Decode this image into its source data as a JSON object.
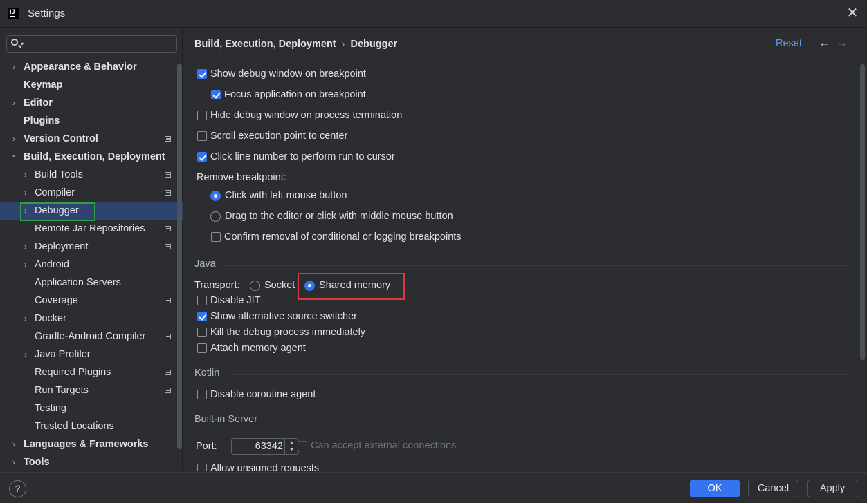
{
  "window": {
    "title": "Settings",
    "app_icon_text": "IJ"
  },
  "search": {
    "placeholder": ""
  },
  "sidebar": {
    "items": [
      {
        "label": "Appearance & Behavior",
        "level": 0,
        "chevron": "right"
      },
      {
        "label": "Keymap",
        "level": 0,
        "chevron": "none"
      },
      {
        "label": "Editor",
        "level": 0,
        "chevron": "right"
      },
      {
        "label": "Plugins",
        "level": 0,
        "chevron": "none"
      },
      {
        "label": "Version Control",
        "level": 0,
        "chevron": "right",
        "project_icon": true
      },
      {
        "label": "Build, Execution, Deployment",
        "level": 0,
        "chevron": "down"
      },
      {
        "label": "Build Tools",
        "level": 1,
        "chevron": "right",
        "project_icon": true
      },
      {
        "label": "Compiler",
        "level": 1,
        "chevron": "right",
        "project_icon": true
      },
      {
        "label": "Debugger",
        "level": 1,
        "chevron": "right",
        "selected": true
      },
      {
        "label": "Remote Jar Repositories",
        "level": 1,
        "chevron": "none",
        "project_icon": true
      },
      {
        "label": "Deployment",
        "level": 1,
        "chevron": "right",
        "project_icon": true
      },
      {
        "label": "Android",
        "level": 1,
        "chevron": "right"
      },
      {
        "label": "Application Servers",
        "level": 1,
        "chevron": "none"
      },
      {
        "label": "Coverage",
        "level": 1,
        "chevron": "none",
        "project_icon": true
      },
      {
        "label": "Docker",
        "level": 1,
        "chevron": "right"
      },
      {
        "label": "Gradle-Android Compiler",
        "level": 1,
        "chevron": "none",
        "project_icon": true
      },
      {
        "label": "Java Profiler",
        "level": 1,
        "chevron": "right"
      },
      {
        "label": "Required Plugins",
        "level": 1,
        "chevron": "none",
        "project_icon": true
      },
      {
        "label": "Run Targets",
        "level": 1,
        "chevron": "none",
        "project_icon": true
      },
      {
        "label": "Testing",
        "level": 1,
        "chevron": "none"
      },
      {
        "label": "Trusted Locations",
        "level": 1,
        "chevron": "none"
      },
      {
        "label": "Languages & Frameworks",
        "level": 0,
        "chevron": "right"
      },
      {
        "label": "Tools",
        "level": 0,
        "chevron": "right"
      }
    ]
  },
  "header": {
    "breadcrumb_parent": "Build, Execution, Deployment",
    "breadcrumb_sep": "›",
    "breadcrumb_current": "Debugger",
    "reset_label": "Reset",
    "back_glyph": "←",
    "forward_glyph": "→"
  },
  "debugger": {
    "show_debug_window": {
      "label": "Show debug window on breakpoint",
      "checked": true
    },
    "focus_application": {
      "label": "Focus application on breakpoint",
      "checked": true
    },
    "hide_debug_window": {
      "label": "Hide debug window on process termination",
      "checked": false
    },
    "scroll_execution": {
      "label": "Scroll execution point to center",
      "checked": false
    },
    "click_line_number": {
      "label": "Click line number to perform run to cursor",
      "checked": true
    },
    "remove_breakpoint_label": "Remove breakpoint:",
    "remove_click_left": {
      "label": "Click with left mouse button",
      "selected": true
    },
    "remove_drag": {
      "label": "Drag to the editor or click with middle mouse button",
      "selected": false
    },
    "confirm_removal": {
      "label": "Confirm removal of conditional or logging breakpoints",
      "checked": false
    }
  },
  "java": {
    "section_title": "Java",
    "transport_label": "Transport:",
    "socket": {
      "label": "Socket",
      "selected": false
    },
    "shared_memory": {
      "label": "Shared memory",
      "selected": true
    },
    "disable_jit": {
      "label": "Disable JIT",
      "checked": false
    },
    "show_alt_source": {
      "label": "Show alternative source switcher",
      "checked": true
    },
    "kill_debug": {
      "label": "Kill the debug process immediately",
      "checked": false
    },
    "attach_memory": {
      "label": "Attach memory agent",
      "checked": false
    }
  },
  "kotlin": {
    "section_title": "Kotlin",
    "disable_coroutine": {
      "label": "Disable coroutine agent",
      "checked": false
    }
  },
  "builtin_server": {
    "section_title": "Built-in Server",
    "port_label": "Port:",
    "port_value": "63342",
    "external_connections": {
      "label": "Can accept external connections",
      "checked": false,
      "enabled": false
    },
    "allow_unsigned": {
      "label": "Allow unsigned requests",
      "checked": false
    }
  },
  "footer": {
    "help_glyph": "?",
    "ok_label": "OK",
    "cancel_label": "Cancel",
    "apply_label": "Apply"
  },
  "colors": {
    "accent": "#3574f0",
    "link": "#5b9bf8",
    "selection": "#2e436e",
    "highlight_green": "#2ea043",
    "highlight_red": "#d83b3b"
  }
}
